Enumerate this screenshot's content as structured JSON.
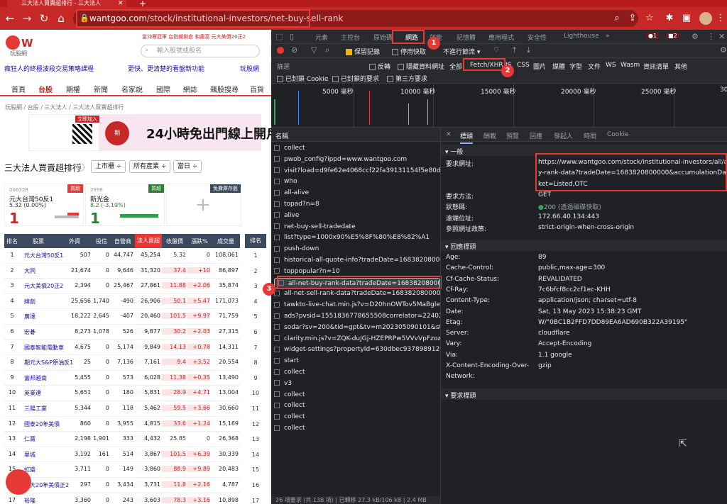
{
  "browser": {
    "tab_title": "三大法人買賣超排行 - 三大法人",
    "url_host": "wantgoo.com",
    "url_path": "/stock/institutional-investors/net-buy-sell-rank"
  },
  "site": {
    "logo_text": "玩股網",
    "promo": "當沖賽冠軍 台指期鎖倉 和農富  元大美債20正2",
    "search_placeholder": "輸入股號或股名",
    "slogans": [
      "瘋狂人的終極波段交易策略課程",
      "更快、更清楚的看盤新功能",
      "玩股網"
    ],
    "nav": [
      "首頁",
      "台股",
      "期權",
      "新聞",
      "名家說",
      "國際",
      "網誌",
      "飆股搜尋",
      "百貨"
    ],
    "breadcrumb": "玩股網 / 台股 / 三大法人 / 三大法人買賣超排行",
    "banner_text": "24小時免出門線上開戶",
    "banner_tag": "立即加入",
    "page_title": "三大法人買賣超排行",
    "selects": [
      "上市櫃 ÷",
      "所有產業 ÷",
      "當日 ÷"
    ],
    "cards": [
      {
        "code": "00632R",
        "name": "元大台灣50反1",
        "price": "5.32 (0.00%)",
        "big": "1",
        "badge": "買超"
      },
      {
        "code": "2898",
        "name": "新光金",
        "price": "8.2 (-3.19%)",
        "big": "1",
        "badge": "買超"
      },
      {
        "code": "",
        "name": "",
        "price": "",
        "big": "",
        "badge": "免費庫存股"
      }
    ],
    "table_headers": [
      "排名",
      "股票",
      "外資",
      "投信",
      "自營商",
      "法人買超",
      "收盤價",
      "漲跌%",
      "成交量"
    ],
    "side_header": "排名",
    "rows": [
      [
        "1",
        "元大台灣50反1",
        "507",
        "0",
        "44,747",
        "45,254",
        "5.32",
        "0",
        "108,061"
      ],
      [
        "2",
        "大同",
        "21,674",
        "0",
        "9,646",
        "31,320",
        "37.4",
        "+10",
        "86,897"
      ],
      [
        "3",
        "元大美債20正2",
        "2,394",
        "0",
        "25,467",
        "27,861",
        "11.88",
        "+2.06",
        "35,874"
      ],
      [
        "4",
        "緯創",
        "25,656",
        "1,740",
        "-490",
        "26,906",
        "50.1",
        "+5.47",
        "171,073"
      ],
      [
        "5",
        "廣達",
        "18,222",
        "2,645",
        "-407",
        "20,460",
        "101.5",
        "+9.97",
        "71,759"
      ],
      [
        "6",
        "宏碁",
        "8,273",
        "1,078",
        "526",
        "9,877",
        "30.2",
        "+2.03",
        "27,315"
      ],
      [
        "7",
        "國泰智能電動車",
        "4,675",
        "0",
        "5,174",
        "9,849",
        "14.13",
        "+0.78",
        "14,311"
      ],
      [
        "8",
        "期元大S&P原油反1",
        "25",
        "0",
        "7,136",
        "7,161",
        "9.4",
        "+3.52",
        "20,554"
      ],
      [
        "9",
        "富邦越南",
        "5,455",
        "0",
        "573",
        "6,028",
        "11.38",
        "+0.35",
        "13,490"
      ],
      [
        "10",
        "英業達",
        "5,651",
        "0",
        "180",
        "5,831",
        "28.9",
        "+4.71",
        "13,004"
      ],
      [
        "11",
        "三陽工業",
        "5,344",
        "0",
        "118",
        "5,462",
        "59.5",
        "+3.66",
        "30,660"
      ],
      [
        "12",
        "國泰20年美債",
        "860",
        "0",
        "3,955",
        "4,815",
        "33.6",
        "+1.24",
        "15,169"
      ],
      [
        "13",
        "仁寶",
        "2,198",
        "1,901",
        "333",
        "4,432",
        "25.85",
        "0",
        "26,368"
      ],
      [
        "14",
        "華城",
        "3,192",
        "161",
        "514",
        "3,867",
        "101.5",
        "+6.39",
        "30,339"
      ],
      [
        "15",
        "虹盛",
        "3,711",
        "0",
        "149",
        "3,860",
        "88.9",
        "+9.89",
        "20,483"
      ],
      [
        "16",
        "元大20年美債正2",
        "297",
        "0",
        "3,434",
        "3,731",
        "11.8",
        "+2.16",
        "4,787"
      ],
      [
        "17",
        "裕隆",
        "3,360",
        "0",
        "243",
        "3,603",
        "78.3",
        "+3.16",
        "10,898"
      ]
    ]
  },
  "devtools": {
    "tabs": [
      "元素",
      "主控台",
      "原始碼",
      "網路",
      "效能",
      "記憶體",
      "應用程式",
      "安全性",
      "Lighthouse",
      "»"
    ],
    "errors": "1",
    "warnings": "2",
    "toolbar": {
      "preserve": "保留記錄",
      "disable_cache": "停用快取",
      "throttle": "不進行節流"
    },
    "filter": {
      "placeholder": "篩選",
      "invert": "反轉",
      "hide_data": "隱藏資料網址",
      "all": "全部",
      "types": [
        "Fetch/XHR",
        "JS",
        "CSS",
        "圖片",
        "媒體",
        "字型",
        "文件",
        "WS",
        "Wasm",
        "資訊清單",
        "其他"
      ]
    },
    "filter2": [
      "已封鎖 Cookie",
      "已封鎖的要求",
      "第三方要求"
    ],
    "timeline": [
      "5000 毫秒",
      "10000 毫秒",
      "15000 毫秒",
      "20000 毫秒",
      "25000 毫秒",
      "30"
    ],
    "list_header": "名稱",
    "requests": [
      "collect",
      "pwob_config?ippd=www.wantgoo.com",
      "visit?load=d9fe62e4068ccf22fa39131154f5e80d966...",
      "who",
      "all-alive",
      "topad?n=8",
      "alive",
      "net-buy-sell-tradedate",
      "list?type=1000x90%E5%8F%80%E8%82%A1",
      "push-down",
      "historical-all-quote-info?tradeDate=1683820800000",
      "toppopular?n=10",
      "all-net-buy-rank-data?tradeDate=1683820800000&...",
      "all-net-sell-rank-data?tradeDate=1683820800000&...",
      "tawkto-live-chat.min.js?v=D20hnOWTov5MaBglet-JI...",
      "ads?pvsid=1551836778655508correlator=2240201...",
      "sodar?sv=200&tid=gpt&tv=m202305090101&st=env",
      "clarity.min.js?v=ZQK-duJGj-HZEPRPw5VVvVpFzozy2...",
      "widget-settings?propertyId=630dbec937898912e96...",
      "start",
      "collect",
      "v3",
      "collect",
      "collect",
      "collect",
      "collect"
    ],
    "footer": "26 項要求 (共 138 項) | 已轉移 27.3 kB/106 kB | 2.4 MB",
    "detail_tabs": [
      "✕",
      "標頭",
      "酬載",
      "預覽",
      "回應",
      "發起人",
      "時間",
      "Cookie"
    ],
    "general_title": "一般",
    "general": [
      {
        "k": "要求網址:",
        "v": "https://www.wantgoo.com/stock/institutional-investors/all/all-net-"
      },
      {
        "k": "",
        "v": "y-rank-data?tradeDate=1683820800000&accumulationDays=1&m"
      },
      {
        "k": "",
        "v": "ket=Listed,OTC"
      },
      {
        "k": "要求方法:",
        "v": "GET"
      },
      {
        "k": "狀態碼:",
        "v": "200 (透過磁碟快取)"
      },
      {
        "k": "遠端位址:",
        "v": "172.66.40.134:443"
      },
      {
        "k": "參照網址政策:",
        "v": "strict-origin-when-cross-origin"
      }
    ],
    "response_title": "回應標頭",
    "response": [
      {
        "k": "Age:",
        "v": "89"
      },
      {
        "k": "Cache-Control:",
        "v": "public,max-age=300"
      },
      {
        "k": "Cf-Cache-Status:",
        "v": "REVALIDATED"
      },
      {
        "k": "Cf-Ray:",
        "v": "7c6bfcf8cc2cf1ec-KHH"
      },
      {
        "k": "Content-Type:",
        "v": "application/json; charset=utf-8"
      },
      {
        "k": "Date:",
        "v": "Sat, 13 May 2023 15:38:23 GMT"
      },
      {
        "k": "Etag:",
        "v": "W/\"0BC1B2FFD7DD89EA6AD690B322A39195\""
      },
      {
        "k": "Server:",
        "v": "cloudflare"
      },
      {
        "k": "Vary:",
        "v": "Accept-Encoding"
      },
      {
        "k": "Via:",
        "v": "1.1 google"
      },
      {
        "k": "X-Content-Encoding-Over-",
        "v": "gzip"
      },
      {
        "k": "Network:",
        "v": ""
      }
    ],
    "request_title": "要求標頭"
  },
  "callouts": [
    "1",
    "2",
    "3"
  ],
  "colors": {
    "accent": "#e53935",
    "up": "#c62828",
    "down": "#2e7d32",
    "devtools_bg": "#202124"
  }
}
